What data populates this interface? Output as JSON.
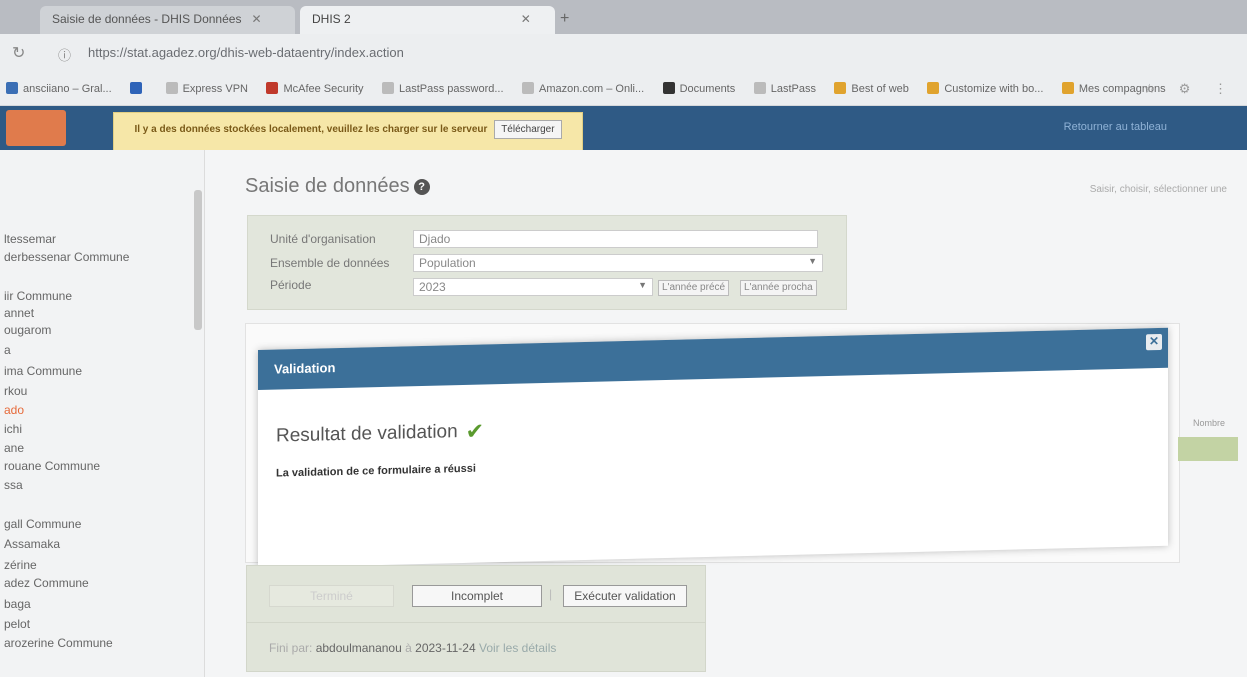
{
  "browser": {
    "tabs": [
      {
        "label": "Saisie de données - DHIS Données"
      },
      {
        "label": "DHIS 2"
      }
    ],
    "url": "https://stat.agadez.org/dhis-web-dataentry/index.action",
    "bookmarks": [
      {
        "label": "ansciiano – Gral...",
        "color": "#3b6fb5"
      },
      {
        "label": "",
        "color": "#2e63b8"
      },
      {
        "label": "Express VPN",
        "color": "#bbb"
      },
      {
        "label": "McAfee Security",
        "color": "#c0392b"
      },
      {
        "label": "LastPass password...",
        "color": "#bbb"
      },
      {
        "label": "Amazon.com – Onli...",
        "color": "#bbb"
      },
      {
        "label": "Documents",
        "color": "#333"
      },
      {
        "label": "LastPass",
        "color": "#bbb"
      },
      {
        "label": "Best of web",
        "color": "#e0a32e"
      },
      {
        "label": "Customize with bo...",
        "color": "#e0a32e"
      },
      {
        "label": "Mes compagnons",
        "color": "#e0a32e"
      }
    ]
  },
  "alert": {
    "text": "Il y a des données stockées localement, veuillez les charger sur le serveur",
    "button": "Télécharger"
  },
  "header": {
    "link": "Retourner au tableau"
  },
  "sidebar": {
    "items": [
      {
        "label": "ltessemar"
      },
      {
        "label": "derbessenar Commune"
      },
      {
        "label": "iir Commune"
      },
      {
        "label": "annet"
      },
      {
        "label": "ougarom"
      },
      {
        "label": "a"
      },
      {
        "label": "ima Commune"
      },
      {
        "label": "rkou"
      },
      {
        "label": "ado"
      },
      {
        "label": "ichi"
      },
      {
        "label": "ane"
      },
      {
        "label": "rouane Commune"
      },
      {
        "label": "ssa"
      },
      {
        "label": "gall Commune"
      },
      {
        "label": "Assamaka"
      },
      {
        "label": "zérine"
      },
      {
        "label": "adez Commune"
      },
      {
        "label": "baga"
      },
      {
        "label": "pelot"
      },
      {
        "label": "arozerine Commune"
      }
    ]
  },
  "main": {
    "title": "Saisie de données",
    "right_note": "Saisir, choisir, sélectionner une",
    "right_col_header": "Nombre",
    "form": {
      "org_label": "Unité d'organisation",
      "org_value": "Djado",
      "dataset_label": "Ensemble de données",
      "dataset_value": "Population",
      "period_label": "Période",
      "period_value": "2023",
      "prev_year": "L'année précé",
      "next_year": "L'année procha"
    },
    "dialog": {
      "title": "Validation",
      "heading": "Resultat de validation",
      "message": "La validation de ce formulaire a réussi"
    },
    "actions": {
      "complete": "Terminé",
      "incomplete": "Incomplet",
      "separator": "|",
      "run_validation": "Exécuter validation"
    },
    "footer": {
      "prefix": "Fini par:",
      "user": "abdoulmananou",
      "at": "à",
      "date": "2023-11-24",
      "details_link": "Voir les détails"
    }
  }
}
